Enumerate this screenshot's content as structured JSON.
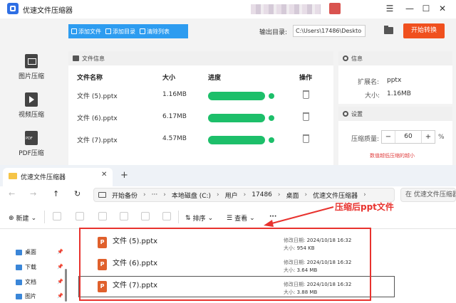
{
  "app": {
    "title": "优速文件压缩器",
    "controls": {
      "menu": "☰",
      "minimize": "—",
      "maximize": "☐",
      "close": "✕"
    }
  },
  "toolbar": {
    "add_file": "添加文件",
    "add_dir": "添加目录",
    "clear_list": "清除列表",
    "output_label": "输出目录:",
    "output_path": "C:\\Users\\17486\\Deskto",
    "start": "开始转换"
  },
  "sidebar": {
    "items": [
      {
        "label": "图片压缩",
        "icon": "image-icon"
      },
      {
        "label": "视频压缩",
        "icon": "video-icon"
      },
      {
        "label": "PDF压缩",
        "icon": "pdf-icon"
      }
    ]
  },
  "file_panel": {
    "heading": "文件信息",
    "columns": {
      "name": "文件名称",
      "size": "大小",
      "progress": "进度",
      "action": "操作"
    },
    "rows": [
      {
        "name": "文件 (5).pptx",
        "size": "1.16MB",
        "progress": 1.0
      },
      {
        "name": "文件 (6).pptx",
        "size": "6.17MB",
        "progress": 1.0
      },
      {
        "name": "文件 (7).pptx",
        "size": "4.57MB",
        "progress": 1.0
      }
    ]
  },
  "info_panel": {
    "heading": "信息",
    "ext_label": "扩展名:",
    "ext_value": "pptx",
    "size_label": "大小:",
    "size_value": "1.16MB"
  },
  "settings_panel": {
    "heading": "设置",
    "quality_label": "压缩质量:",
    "minus": "−",
    "quality_value": "60",
    "plus": "+",
    "unit": "%",
    "hint": "数值越低压缩的越小"
  },
  "explorer": {
    "tab_title": "优速文件压缩器",
    "tab_close": "✕",
    "tab_new": "+",
    "nav": {
      "back": "←",
      "forward": "→",
      "up": "↑",
      "refresh": "↻"
    },
    "breadcrumb": [
      "开始备份",
      "···",
      "本地磁盘 (C:)",
      "用户",
      "17486",
      "桌面",
      "优速文件压缩器"
    ],
    "search_placeholder": "在 优速文件压缩器",
    "commands": {
      "new": "新建",
      "sort": "排序",
      "view": "查看",
      "more": "···"
    },
    "nav_pane": [
      "桌面",
      "下载",
      "文档",
      "图片"
    ],
    "files": [
      {
        "name": "文件 (5).pptx",
        "modified_label": "修改日期:",
        "modified": "2024/10/18 16:32",
        "size_label": "大小:",
        "size": "954 KB"
      },
      {
        "name": "文件 (6).pptx",
        "modified_label": "修改日期:",
        "modified": "2024/10/18 16:32",
        "size_label": "大小:",
        "size": "3.64 MB"
      },
      {
        "name": "文件 (7).pptx",
        "modified_label": "修改日期:",
        "modified": "2024/10/18 16:32",
        "size_label": "大小:",
        "size": "3.88 MB"
      }
    ]
  },
  "annotation": {
    "callout": "压缩后ppt文件",
    "color": "#e8322e"
  }
}
